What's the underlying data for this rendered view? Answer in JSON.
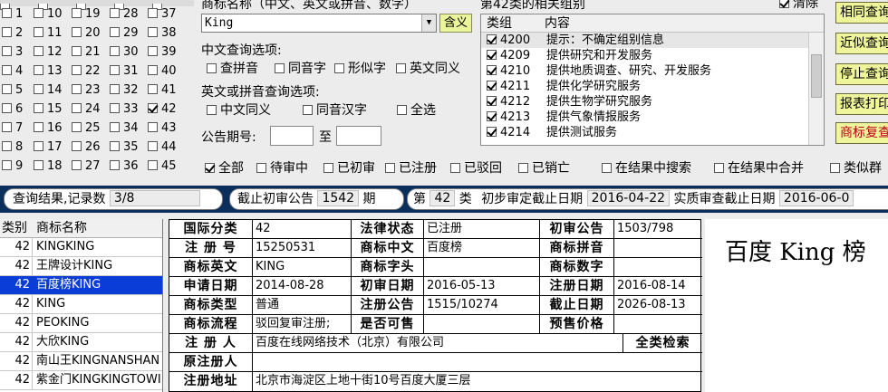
{
  "class_checkboxes": [
    {
      "n": "1",
      "checked": false
    },
    {
      "n": "10",
      "checked": false
    },
    {
      "n": "19",
      "checked": false
    },
    {
      "n": "28",
      "checked": false
    },
    {
      "n": "37",
      "checked": false
    },
    {
      "n": "2",
      "checked": false
    },
    {
      "n": "11",
      "checked": false
    },
    {
      "n": "20",
      "checked": false
    },
    {
      "n": "29",
      "checked": false
    },
    {
      "n": "38",
      "checked": false
    },
    {
      "n": "3",
      "checked": false
    },
    {
      "n": "12",
      "checked": false
    },
    {
      "n": "21",
      "checked": false
    },
    {
      "n": "30",
      "checked": false
    },
    {
      "n": "39",
      "checked": false
    },
    {
      "n": "4",
      "checked": false
    },
    {
      "n": "13",
      "checked": false
    },
    {
      "n": "22",
      "checked": false
    },
    {
      "n": "31",
      "checked": false
    },
    {
      "n": "40",
      "checked": false
    },
    {
      "n": "5",
      "checked": false
    },
    {
      "n": "14",
      "checked": false
    },
    {
      "n": "23",
      "checked": false
    },
    {
      "n": "32",
      "checked": false
    },
    {
      "n": "41",
      "checked": false
    },
    {
      "n": "6",
      "checked": false
    },
    {
      "n": "15",
      "checked": false
    },
    {
      "n": "24",
      "checked": false
    },
    {
      "n": "33",
      "checked": false
    },
    {
      "n": "42",
      "checked": true
    },
    {
      "n": "7",
      "checked": false
    },
    {
      "n": "16",
      "checked": false
    },
    {
      "n": "25",
      "checked": false
    },
    {
      "n": "34",
      "checked": false
    },
    {
      "n": "43",
      "checked": false
    },
    {
      "n": "8",
      "checked": false
    },
    {
      "n": "17",
      "checked": false
    },
    {
      "n": "26",
      "checked": false
    },
    {
      "n": "35",
      "checked": false
    },
    {
      "n": "44",
      "checked": false
    },
    {
      "n": "9",
      "checked": false
    },
    {
      "n": "18",
      "checked": false
    },
    {
      "n": "27",
      "checked": false
    },
    {
      "n": "36",
      "checked": false
    },
    {
      "n": "45",
      "checked": false
    }
  ],
  "search": {
    "name_label": "商标名称（中文、英文或拼音、数字）",
    "name_value": "King",
    "hanyi_button": "含义",
    "cn_options_label": "中文查询选项:",
    "cn_options": [
      "查拼音",
      "同音字",
      "形似字",
      "英文同义"
    ],
    "en_options_label": "英文或拼音查询选项:",
    "en_options": [
      "中文同义",
      "同音汉字",
      "全选"
    ],
    "gazette_label": "公告期号:",
    "gazette_to": "至"
  },
  "groups": {
    "title": "第42类的相关组别",
    "clear_label": "清除",
    "clear_checked": true,
    "col_group": "类组",
    "col_content": "内容",
    "rows": [
      {
        "code": "4200",
        "text": "提示：不确定组别信息"
      },
      {
        "code": "4209",
        "text": "提供研究和开发服务"
      },
      {
        "code": "4210",
        "text": "提供地质调查、研究、开发服务"
      },
      {
        "code": "4211",
        "text": "提供化学研究服务"
      },
      {
        "code": "4212",
        "text": "提供生物学研究服务"
      },
      {
        "code": "4213",
        "text": "提供气象情报服务"
      },
      {
        "code": "4214",
        "text": "提供测试服务"
      }
    ]
  },
  "right_buttons": [
    {
      "label": "相同查询",
      "red": false
    },
    {
      "label": "近似查询",
      "red": false
    },
    {
      "label": "停止查询",
      "red": false
    },
    {
      "label": "报表打印",
      "red": false
    },
    {
      "label": "商标复查",
      "red": true
    }
  ],
  "status_filters": [
    {
      "label": "全部",
      "checked": true
    },
    {
      "label": "待审中",
      "checked": false
    },
    {
      "label": "已初审",
      "checked": false
    },
    {
      "label": "已注册",
      "checked": false
    },
    {
      "label": "已驳回",
      "checked": false
    },
    {
      "label": "已销亡",
      "checked": false
    }
  ],
  "result_options": [
    {
      "label": "在结果中搜索",
      "checked": false
    },
    {
      "label": "在结果中合并",
      "checked": false
    },
    {
      "label": "类似群",
      "checked": false
    }
  ],
  "status": {
    "result_label": "查询结果,记录数",
    "result_value": "3/8",
    "deadline_label": "截止初审公告",
    "deadline_value": "1542",
    "deadline_unit": "期",
    "class_prefix": "第",
    "class_value": "42",
    "class_suffix": "类",
    "initial_label": "初步审定截止日期",
    "initial_value": "2016-04-22",
    "actual_label": "实质审查截止日期",
    "actual_value": "2016-06-0"
  },
  "list": {
    "col_class": "类别",
    "col_name": "商标名称",
    "rows": [
      {
        "cls": "42",
        "name": "KINGKING",
        "selected": false
      },
      {
        "cls": "42",
        "name": "王牌设计KING",
        "selected": false
      },
      {
        "cls": "42",
        "name": "百度榜KING",
        "selected": true
      },
      {
        "cls": "42",
        "name": "KING",
        "selected": false
      },
      {
        "cls": "42",
        "name": "PEOKING",
        "selected": false
      },
      {
        "cls": "42",
        "name": "大欣KING",
        "selected": false
      },
      {
        "cls": "42",
        "name": "南山王KINGNANSHAN",
        "selected": false
      },
      {
        "cls": "42",
        "name": "紫金门KINGKINGTOWI",
        "selected": false
      }
    ]
  },
  "detail": {
    "intl_class_k": "国际分类",
    "intl_class_v": "42",
    "legal_k": "法律状态",
    "legal_v": "已注册",
    "init_pub_k": "初审公告",
    "init_pub_v": "1503/798",
    "reg_no_k": "注 册 号",
    "reg_no_v": "15250531",
    "cn_k": "商标中文",
    "cn_v": "百度榜",
    "pinyin_k": "商标拼音",
    "pinyin_v": "",
    "en_k": "商标英文",
    "en_v": "KING",
    "head_k": "商标字头",
    "head_v": "",
    "num_k": "商标数字",
    "num_v": "",
    "apply_k": "申请日期",
    "apply_v": "2014-08-28",
    "init_date_k": "初审日期",
    "init_date_v": "2016-05-13",
    "reg_date_k": "注册日期",
    "reg_date_v": "2016-08-14",
    "type_k": "商标类型",
    "type_v": "普通",
    "reg_pub_k": "注册公告",
    "reg_pub_v": "1515/10274",
    "expire_k": "截止日期",
    "expire_v": "2026-08-13",
    "flow_k": "商标流程",
    "flow_v": "驳回复审注册;",
    "sale_k": "是否可售",
    "sale_v": "",
    "presale_k": "预售价格",
    "presale_v": "",
    "registrant_k": "注 册 人",
    "registrant_v": "百度在线网络技术（北京）有限公司",
    "full_search": "全类检索",
    "orig_reg_k": "原注册人",
    "orig_reg_v": "",
    "addr_k": "注册地址",
    "addr_v": "北京市海淀区上地十街10号百度大厦三层"
  },
  "preview_name": "百度 King 榜"
}
